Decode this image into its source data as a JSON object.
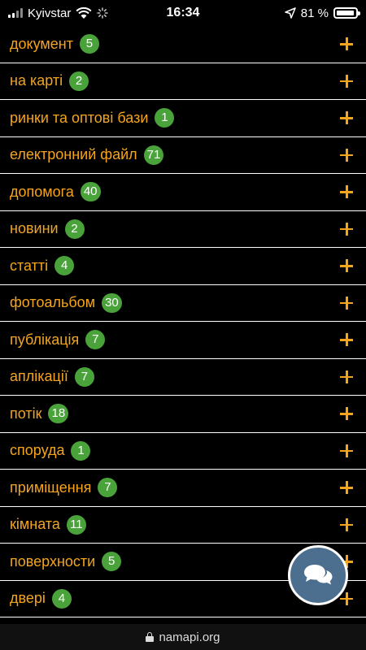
{
  "status_bar": {
    "carrier": "Kyivstar",
    "time": "16:34",
    "battery_percent": "81 %"
  },
  "items": [
    {
      "label": "документ",
      "count": "5"
    },
    {
      "label": "на карті",
      "count": "2"
    },
    {
      "label": "ринки та оптові бази",
      "count": "1"
    },
    {
      "label": "електронний файл",
      "count": "71"
    },
    {
      "label": "допомога",
      "count": "40"
    },
    {
      "label": "новини",
      "count": "2"
    },
    {
      "label": "статті",
      "count": "4"
    },
    {
      "label": "фотоальбом",
      "count": "30"
    },
    {
      "label": "публікація",
      "count": "7"
    },
    {
      "label": "аплікації",
      "count": "7"
    },
    {
      "label": "потік",
      "count": "18"
    },
    {
      "label": "споруда",
      "count": "1"
    },
    {
      "label": "приміщення",
      "count": "7"
    },
    {
      "label": "кімната",
      "count": "11"
    },
    {
      "label": "поверхности",
      "count": "5"
    },
    {
      "label": "двері",
      "count": "4"
    }
  ],
  "url_bar": {
    "domain": "namapi.org"
  },
  "colors": {
    "label": "#f4a51c",
    "badge": "#4aa33a",
    "chat_button": "#4d6f8f"
  },
  "icons": {
    "expand": "plus-icon",
    "chat": "chat-bubbles-icon",
    "secure": "lock-icon"
  }
}
